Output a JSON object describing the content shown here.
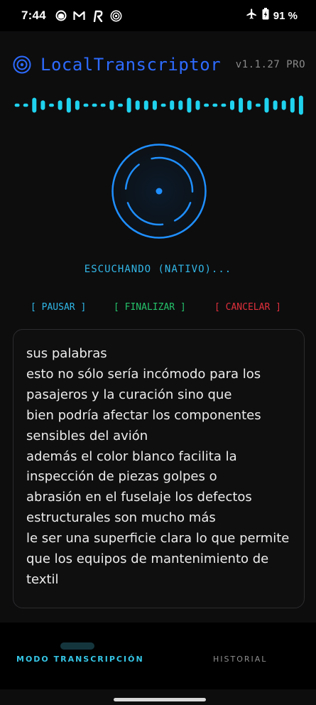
{
  "status_bar": {
    "time": "7:44",
    "notification_icons": [
      "app-icon",
      "gmail-icon",
      "r-app-icon",
      "target-icon"
    ],
    "system_icons": [
      "airplane-mode-icon",
      "battery-charging-icon"
    ],
    "battery_percent": "91 %"
  },
  "header": {
    "title": "LocalTranscriptor",
    "version": "v1.1.27 PRO",
    "accent_color": "#2d6bff"
  },
  "waveform": {
    "color": "#1fd2ee",
    "bars": [
      0.15,
      0.15,
      0.7,
      0.45,
      0.15,
      0.45,
      0.7,
      0.45,
      0.15,
      0.15,
      0.15,
      0.45,
      0.15,
      0.7,
      0.45,
      0.45,
      0.45,
      0.15,
      0.45,
      0.45,
      0.7,
      0.45,
      0.15,
      0.15,
      0.15,
      0.45,
      0.7,
      0.45,
      0.15,
      0.7,
      0.45,
      0.45,
      0.7,
      0.9
    ]
  },
  "listening": {
    "status": "ESCUCHANDO (NATIVO)..."
  },
  "controls": {
    "pause": "[ PAUSAR ]",
    "finish": "[ FINALIZAR ]",
    "cancel": "[ CANCELAR ]"
  },
  "transcript": {
    "lines": [
      "sus palabras",
      "esto no sólo sería incómodo para los",
      "pasajeros y la curación sino que",
      "bien podría afectar los componentes",
      "sensibles del avión",
      "además el color blanco facilita la",
      "inspección de piezas golpes o",
      "abrasión en el fuselaje los defectos",
      "estructurales son mucho más",
      "le ser una superficie clara lo que permite",
      "que los equipos de mantenimiento de",
      "textil"
    ]
  },
  "bottom_nav": {
    "tabs": [
      {
        "label": "MODO TRANSCRIPCIÓN",
        "active": true
      },
      {
        "label": "HISTORIAL",
        "active": false
      }
    ]
  }
}
